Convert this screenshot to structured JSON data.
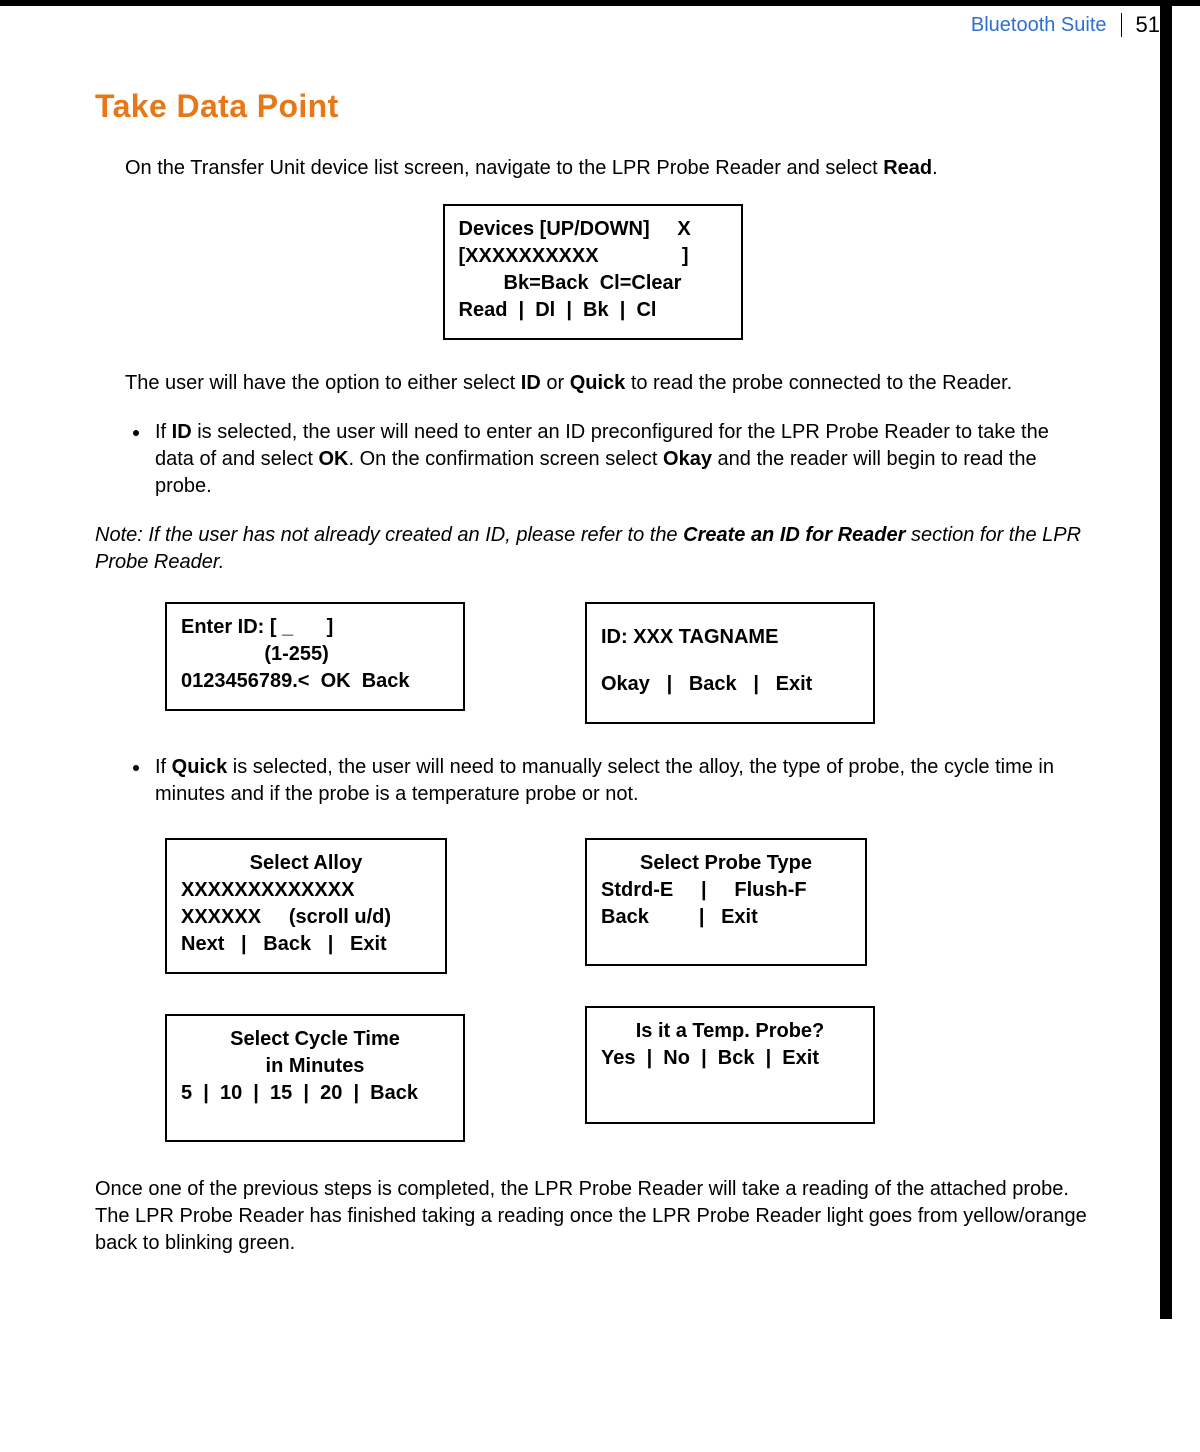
{
  "header": {
    "breadcrumb": "Bluetooth Suite",
    "page_number": "51"
  },
  "title": "Take Data Point",
  "para1_pre": "On the Transfer Unit device list screen, navigate to the LPR Probe Reader and select ",
  "para1_bold": "Read",
  "para1_post": ".",
  "devices_box": {
    "l1": "Devices [UP/DOWN]     X",
    "l2": "[XXXXXXXXXX               ]",
    "l3": "Bk=Back  Cl=Clear",
    "l4": "Read  |  Dl  |  Bk  |  Cl"
  },
  "para2_pre": "The user will have the option to either select ",
  "para2_b1": "ID",
  "para2_mid": " or ",
  "para2_b2": "Quick",
  "para2_post": " to read the probe connected to the Reader.",
  "bullet_id": {
    "pre": "If ",
    "b1": "ID",
    "mid1": " is selected, the user will need to enter an ID preconfigured for the LPR Probe Reader to take the data of and select ",
    "b2": "OK",
    "mid2": ". On the confirmation screen select ",
    "b3": "Okay",
    "post": " and the reader will begin to read the probe."
  },
  "note": {
    "pre": "Note: If the user has not already created an ID, please refer to the ",
    "bold": "Create an ID for Reader",
    "post": " section for the LPR Probe Reader."
  },
  "enter_id_box": {
    "l1": "Enter ID: [ _      ]",
    "l2": "               (1-255)",
    "l3": "",
    "l4": "0123456789.<  OK  Back"
  },
  "id_tag_box": {
    "l1": "ID: XXX TAGNAME",
    "l2": "Okay   |   Back   |   Exit"
  },
  "bullet_quick": {
    "pre": "If ",
    "b1": "Quick",
    "post": " is selected, the user will need to manually select the alloy, the type of probe, the cycle time in minutes and if the probe is a temperature probe or not."
  },
  "select_alloy_box": {
    "l1": "Select Alloy",
    "l2": "XXXXXXXXXXXXX",
    "l3": "XXXXXX     (scroll u/d)",
    "l4": "Next   |   Back   |   Exit"
  },
  "select_probe_box": {
    "l1": "Select Probe Type",
    "l2": "",
    "l3": "Stdrd-E     |     Flush-F",
    "l4": "Back         |   Exit"
  },
  "select_cycle_box": {
    "l1": "Select Cycle Time",
    "l2": "in Minutes",
    "l3": "",
    "l4": "5  |  10  |  15  |  20  |  Back"
  },
  "temp_probe_box": {
    "l1": "Is it a Temp. Probe?",
    "l2": "",
    "l3": "Yes  |  No  |  Bck  |  Exit"
  },
  "para_final": "Once one of the previous steps is completed, the LPR Probe Reader will take a reading of the attached probe. The LPR Probe Reader has finished taking a reading once the LPR Probe Reader light goes from yellow/orange back to blinking green."
}
